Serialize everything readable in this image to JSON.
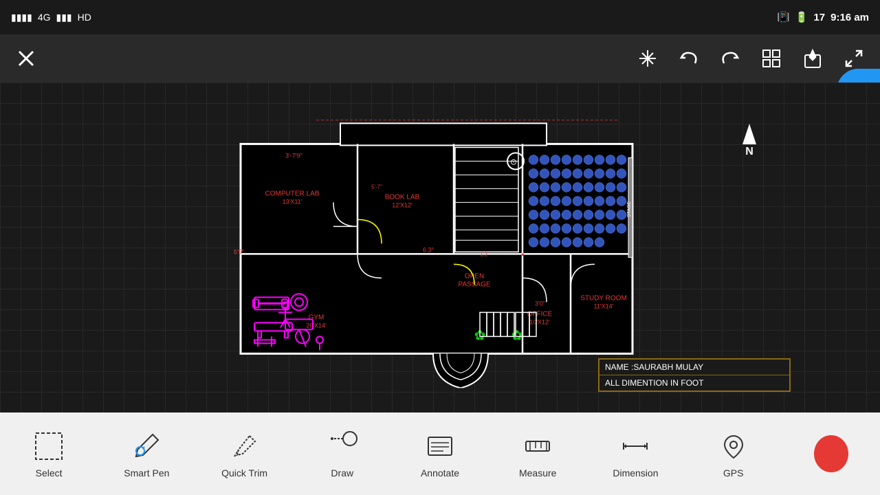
{
  "statusBar": {
    "signal": "4G",
    "networkBars": "||||",
    "hd": "HD",
    "batteryLevel": "17",
    "time": "9:16 am"
  },
  "toolbar": {
    "closeLabel": "✕",
    "sparkleLabel": "✳",
    "undoLabel": "↩",
    "redoLabel": "↪",
    "gridLabel": "⊞",
    "shareLabel": "⬆",
    "expandLabel": "⤢",
    "menuLabel": "≡"
  },
  "floorPlan": {
    "northLabel": "N",
    "infoName": "NAME :SAURABH MULAY",
    "infoDimension": "ALL DIMENTION IN FOOT",
    "rooms": [
      {
        "name": "COMPUTER LAB",
        "size": "13'X11'"
      },
      {
        "name": "BOOK LAB",
        "size": "12'X12'"
      },
      {
        "name": "OPEN PASSAGE",
        "size": ""
      },
      {
        "name": "GYM",
        "size": "26'X14'"
      },
      {
        "name": "OFFICE",
        "size": "10'X12'"
      },
      {
        "name": "STUDY ROOM",
        "size": "11'X14'"
      }
    ]
  },
  "bottomToolbar": {
    "items": [
      {
        "id": "select",
        "label": "Select",
        "icon": "select-icon"
      },
      {
        "id": "smart-pen",
        "label": "Smart Pen",
        "icon": "smart-pen-icon"
      },
      {
        "id": "quick-trim",
        "label": "Quick Trim",
        "icon": "quick-trim-icon"
      },
      {
        "id": "draw",
        "label": "Draw",
        "icon": "draw-icon"
      },
      {
        "id": "annotate",
        "label": "Annotate",
        "icon": "annotate-icon"
      },
      {
        "id": "measure",
        "label": "Measure",
        "icon": "measure-icon"
      },
      {
        "id": "dimension",
        "label": "Dimension",
        "icon": "dimension-icon"
      },
      {
        "id": "gps",
        "label": "GPS",
        "icon": "gps-icon"
      },
      {
        "id": "record",
        "label": "",
        "icon": "record-icon"
      }
    ]
  }
}
